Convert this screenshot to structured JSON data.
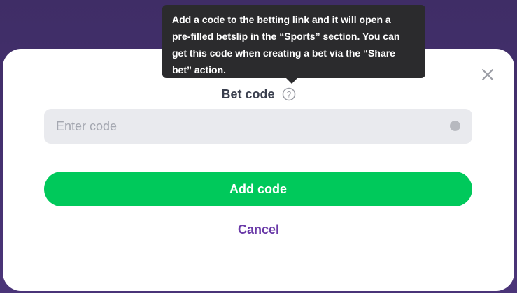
{
  "tooltip": {
    "lines": [
      "Add a code to the betting link and it will open a",
      "pre-filled betslip in the “Sports” section. You can",
      "get this code when creating a bet via the “Share",
      "bet” action."
    ]
  },
  "dialog": {
    "field_label": "Bet code",
    "help_icon": "question-circle-icon",
    "close_icon": "close-icon",
    "input": {
      "value": "",
      "placeholder": "Enter code"
    },
    "add_button_label": "Add code",
    "cancel_label": "Cancel"
  },
  "colors": {
    "backdrop": "#45306f",
    "primary_button": "#00c95b",
    "cancel_text": "#6a3aa8",
    "tooltip_bg": "#2b2b2d",
    "input_bg": "#e9eaee"
  }
}
